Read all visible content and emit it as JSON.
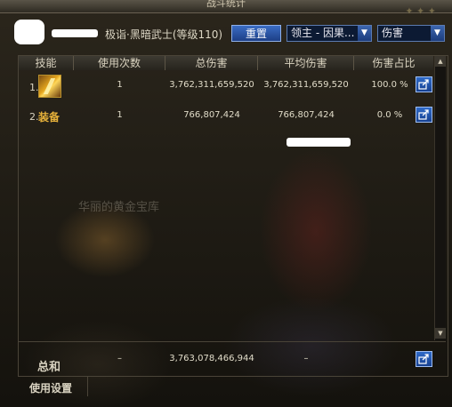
{
  "window": {
    "title": "战斗统计"
  },
  "header": {
    "char_name": "极诣·黑暗武士",
    "char_level": "(等级110)",
    "reset_label": "重置",
    "target_select": "领主 - 因果...",
    "metric_select": "伤害"
  },
  "table": {
    "columns": [
      "技能",
      "使用次数",
      "总伤害",
      "平均伤害",
      "伤害占比"
    ],
    "rows": [
      {
        "num": "1.",
        "skill_icon": "lightning-skill-icon",
        "uses": "1",
        "total": "3,762,311,659,520",
        "avg": "3,762,311,659,520",
        "share": "100.0 %"
      },
      {
        "num": "2.",
        "label": "装备",
        "uses": "1",
        "total": "766,807,424",
        "avg": "766,807,424",
        "share": "0.0 %"
      }
    ]
  },
  "summary": {
    "label": "总和",
    "uses": "–",
    "total": "3,763,078,466,944",
    "avg": "–"
  },
  "footer": {
    "settings_label": "使用设置"
  },
  "background": {
    "watermark": "华丽的黄金宝库"
  },
  "colors": {
    "accent": "#2f6ac8",
    "equip": "#e8b23a"
  }
}
